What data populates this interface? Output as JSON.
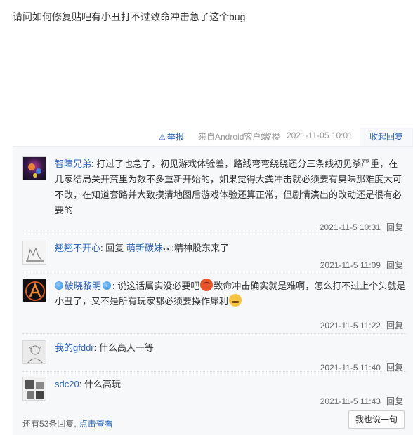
{
  "post": {
    "text": "请问如何修复贴吧有小丑打不过致命冲击急了这个bug"
  },
  "meta": {
    "report_label": "举报",
    "source": "来自Android客户端",
    "floor": "7楼",
    "time": "2021-11-05 10:01",
    "collapse_label": "收起回复"
  },
  "replies": [
    {
      "user": "智障兄弟",
      "content": "打过了也急了，初见游戏体验差，路线弯弯绕绕还分三条线初见杀严重，在几家结局关开荒里为数不多重新开始的，如果觉得大粪冲击就必须要有臭味那难度大可不改，在知道套路并大致摸清地图后游戏体验还算正常，但剧情演出的改动还是很有必要的",
      "time": "2021-11-5 10:31",
      "reply_label": "回复"
    },
    {
      "user": "翘翘不开心",
      "prefix": "回复",
      "target": "萌新碳妹",
      "content": ":精神股东来了",
      "time": "2021-11-5 11:09",
      "reply_label": "回复"
    },
    {
      "user": "破晓黎明",
      "content_a": "说这话属实没必要吧",
      "content_b": "致命冲击确实就是难啊，怎么打不过上个头就是小丑了，又不是所有玩家都必须要操作犀利",
      "time": "2021-11-5 11:22",
      "reply_label": "回复"
    },
    {
      "user": "我的gfddr",
      "content": "什么高人一等",
      "time": "2021-11-5 11:40",
      "reply_label": "回复"
    },
    {
      "user": "sdc20",
      "content": "什么高玩",
      "time": "2021-11-5 11:43",
      "reply_label": "回复"
    }
  ],
  "footer": {
    "more_text": "还有53条回复,",
    "more_link": "点击查看",
    "say_button": "我也说一句"
  },
  "icons": {
    "report": "warning-icon",
    "badge": "badge-icon",
    "emoji_1": "angry-face-emoji",
    "emoji_2": "grinning-face-emoji"
  }
}
